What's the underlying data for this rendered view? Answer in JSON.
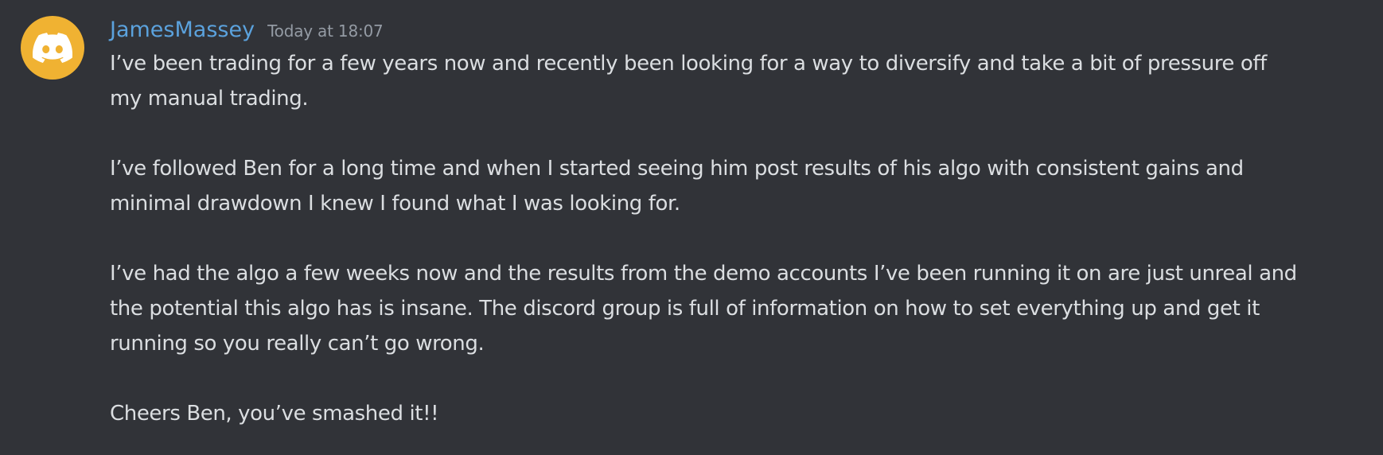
{
  "message": {
    "author": {
      "name": "JamesMassey",
      "name_color": "#5ba2dd",
      "avatar_icon": "discord-logo-icon",
      "avatar_color": "#f0b232"
    },
    "timestamp": "Today at 18:07",
    "paragraphs": [
      "I’ve been trading for a few years now and recently been looking for a way to diversify and take a bit of pressure off my manual trading.",
      "I’ve followed Ben for a long time and when I started seeing him post results of his algo with consistent gains and minimal drawdown I knew I found what I was looking for.",
      "I’ve had the algo a few weeks now and the results from the demo accounts I’ve been running it on are just unreal and the potential this algo has is insane. The discord group is full of information on how to set everything up and get it running so you really can’t go wrong.",
      "Cheers Ben, you’ve smashed it!!"
    ]
  },
  "theme": {
    "background": "#313338",
    "text": "#dbdee1",
    "muted": "#949ba4"
  }
}
